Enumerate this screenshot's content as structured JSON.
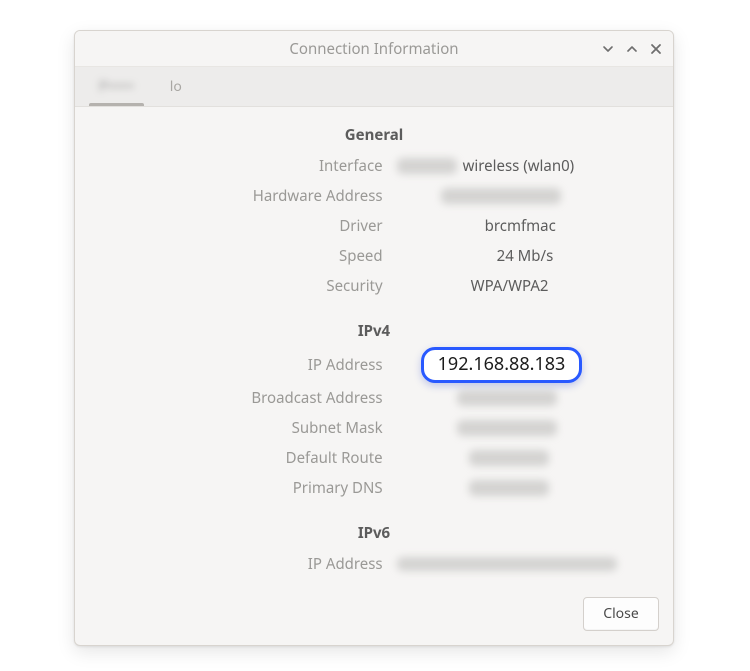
{
  "window": {
    "title": "Connection Information"
  },
  "tabs": [
    {
      "label": "P•••••",
      "active": true,
      "blurred": true
    },
    {
      "label": "lo",
      "active": false,
      "blurred": false
    }
  ],
  "sections": {
    "general": {
      "title": "General",
      "rows": {
        "interface": {
          "label": "Interface",
          "value": "wireless (wlan0)",
          "prefix_blur": true
        },
        "hardware_address": {
          "label": "Hardware Address",
          "redacted": true
        },
        "driver": {
          "label": "Driver",
          "value": "brcmfmac"
        },
        "speed": {
          "label": "Speed",
          "value": "24 Mb/s"
        },
        "security": {
          "label": "Security",
          "value": "WPA/WPA2"
        }
      }
    },
    "ipv4": {
      "title": "IPv4",
      "rows": {
        "ip_address": {
          "label": "IP Address",
          "value": "192.168.88.183",
          "highlighted": true
        },
        "broadcast_address": {
          "label": "Broadcast Address",
          "redacted": true
        },
        "subnet_mask": {
          "label": "Subnet Mask",
          "redacted": true
        },
        "default_route": {
          "label": "Default Route",
          "redacted": true
        },
        "primary_dns": {
          "label": "Primary DNS",
          "redacted": true
        }
      }
    },
    "ipv6": {
      "title": "IPv6",
      "rows": {
        "ip_address": {
          "label": "IP Address",
          "redacted": true,
          "wide": true
        }
      }
    }
  },
  "buttons": {
    "close": "Close"
  },
  "highlight_color": "#2959ff"
}
